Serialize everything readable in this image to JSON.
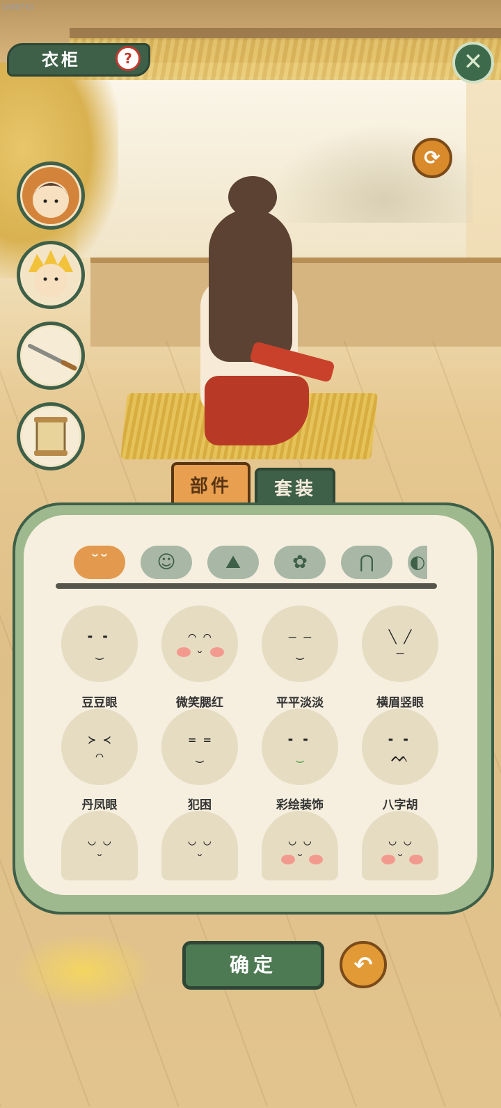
{
  "header": {
    "title": "衣柜",
    "help_glyph": "?",
    "watermark": "1080743"
  },
  "controls": {
    "close_glyph": "✕",
    "refresh_glyph": "⟳",
    "back_glyph": "↶"
  },
  "tabs": [
    {
      "label": "部件",
      "active": true
    },
    {
      "label": "套装",
      "active": false
    }
  ],
  "categories": [
    {
      "icon": "face-icon",
      "glyph": "˘˘",
      "active": true
    },
    {
      "icon": "hair-icon",
      "glyph": "☺",
      "active": false
    },
    {
      "icon": "clothes-icon",
      "glyph": "⛰",
      "active": false
    },
    {
      "icon": "flower-icon",
      "glyph": "✿",
      "active": false
    },
    {
      "icon": "pants-icon",
      "glyph": "⋂",
      "active": false
    },
    {
      "icon": "more-icon",
      "glyph": "◐",
      "active": false
    }
  ],
  "faces": [
    {
      "label": "豆豆眼",
      "eyes": "╸ ╸",
      "mouth": "‿"
    },
    {
      "label": "微笑腮红",
      "eyes": "◠ ◠",
      "mouth": "ᵕ"
    },
    {
      "label": "平平淡淡",
      "eyes": "— —",
      "mouth": "‿"
    },
    {
      "label": "横眉竖眼",
      "eyes": "╲ ╱",
      "mouth": "—"
    },
    {
      "label": "丹凤眼",
      "eyes": "≻ ≺",
      "mouth": "⌒"
    },
    {
      "label": "犯困",
      "eyes": "= =",
      "mouth": "‿"
    },
    {
      "label": "彩绘装饰",
      "eyes": "╸ ╸",
      "mouth": "‿"
    },
    {
      "label": "八字胡",
      "eyes": "╸ ╸",
      "mouth": "ᨓ"
    },
    {
      "label": "",
      "eyes": "◡ ◡",
      "mouth": "ᵕ"
    },
    {
      "label": "",
      "eyes": "◡ ◡",
      "mouth": "ᵕ"
    },
    {
      "label": "",
      "eyes": "◡ ◡",
      "mouth": "ᵕ"
    },
    {
      "label": "",
      "eyes": "◡ ◡",
      "mouth": "ᵕ"
    }
  ],
  "confirm_label": "确定",
  "colors": {
    "primary_green": "#3e5f48",
    "accent_orange": "#e39a4e",
    "blush": "#f39a8e"
  }
}
